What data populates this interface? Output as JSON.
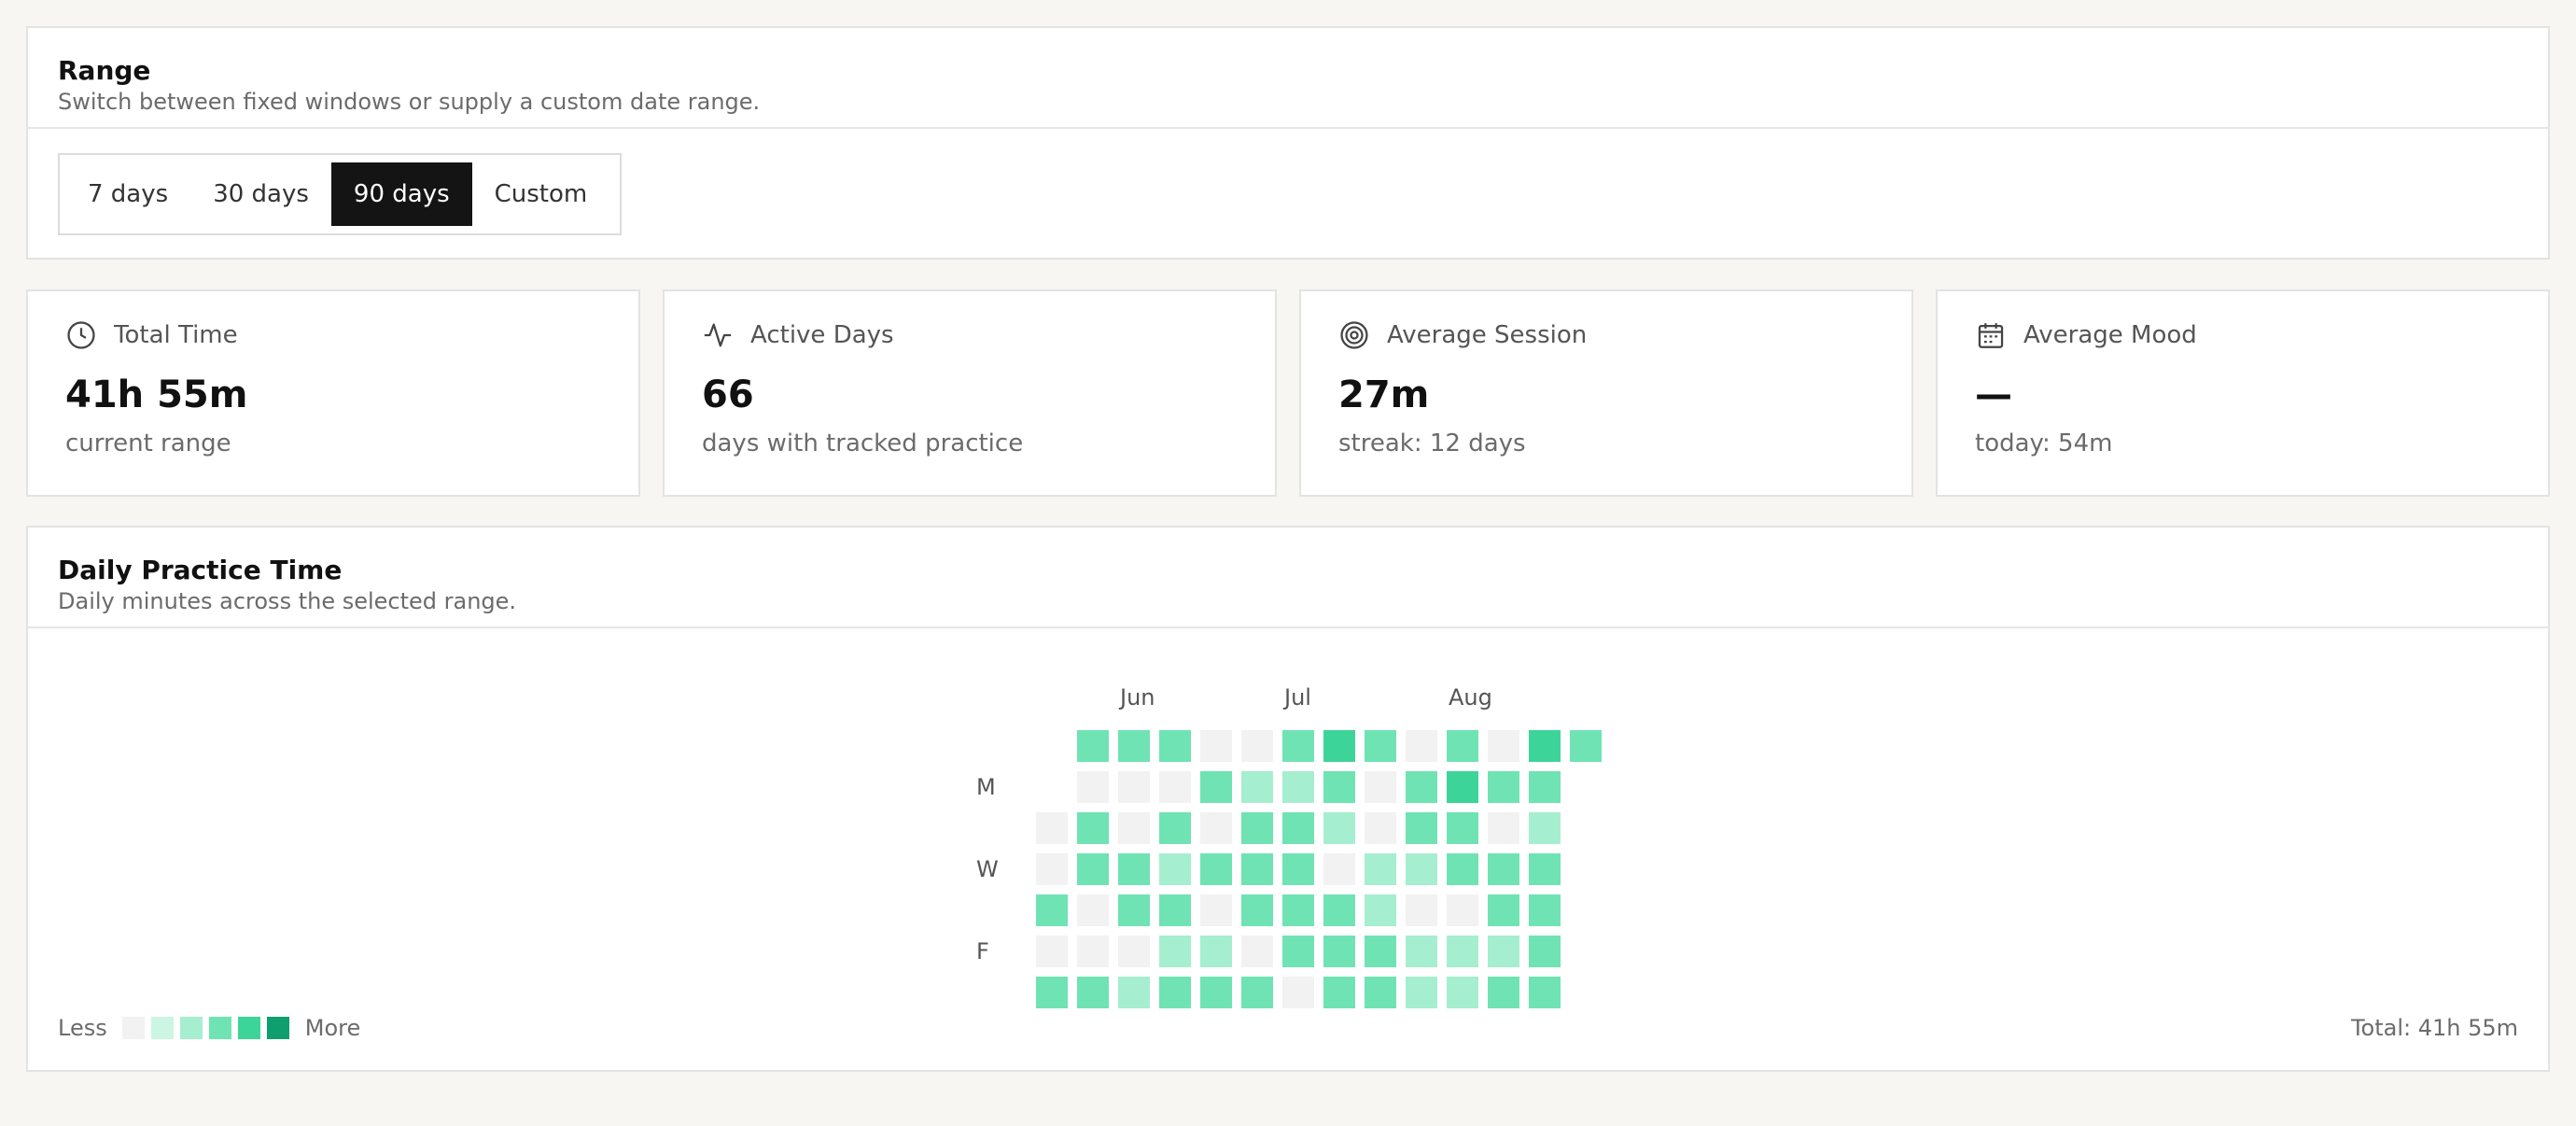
{
  "range": {
    "title": "Range",
    "subtitle": "Switch between fixed windows or supply a custom date range.",
    "options": [
      "7 days",
      "30 days",
      "90 days",
      "Custom"
    ],
    "selected": "90 days"
  },
  "stats": [
    {
      "label": "Total Time",
      "icon": "clock-icon",
      "value": "41h 55m",
      "note": "current range"
    },
    {
      "label": "Active Days",
      "icon": "activity-icon",
      "value": "66",
      "note": "days with tracked practice"
    },
    {
      "label": "Average Session",
      "icon": "target-icon",
      "value": "27m",
      "note": "streak: 12 days"
    },
    {
      "label": "Average Mood",
      "icon": "calendar-icon",
      "value": "—",
      "note": "today: 54m"
    }
  ],
  "practice": {
    "title": "Daily Practice Time",
    "subtitle": "Daily minutes across the selected range.",
    "months": [
      {
        "label": "Jun",
        "col": 2
      },
      {
        "label": "Jul",
        "col": 6
      },
      {
        "label": "Aug",
        "col": 10
      }
    ],
    "day_labels": [
      {
        "label": "M",
        "row": 1
      },
      {
        "label": "W",
        "row": 3
      },
      {
        "label": "F",
        "row": 5
      }
    ],
    "legend_less": "Less",
    "legend_more": "More",
    "total": "Total: 41h 55m",
    "colors": [
      "#f2f2f2",
      "#cdf5e4",
      "#a6eed0",
      "#6fe3b4",
      "#3dd49a",
      "#0f9e6e"
    ],
    "levels": [
      [
        null,
        3,
        3,
        3,
        0,
        0,
        3,
        4,
        3,
        0,
        3,
        0,
        4,
        3
      ],
      [
        null,
        0,
        0,
        0,
        3,
        2,
        2,
        3,
        0,
        3,
        4,
        3,
        3,
        null
      ],
      [
        0,
        3,
        0,
        3,
        0,
        3,
        3,
        2,
        0,
        3,
        3,
        0,
        2,
        null
      ],
      [
        0,
        3,
        3,
        2,
        3,
        3,
        3,
        0,
        2,
        2,
        3,
        3,
        3,
        null
      ],
      [
        3,
        0,
        3,
        3,
        0,
        3,
        3,
        3,
        2,
        0,
        0,
        3,
        3,
        null
      ],
      [
        0,
        0,
        0,
        2,
        2,
        0,
        3,
        3,
        3,
        2,
        2,
        2,
        3,
        null
      ],
      [
        3,
        3,
        2,
        3,
        3,
        3,
        0,
        3,
        3,
        2,
        2,
        3,
        3,
        null
      ]
    ]
  }
}
